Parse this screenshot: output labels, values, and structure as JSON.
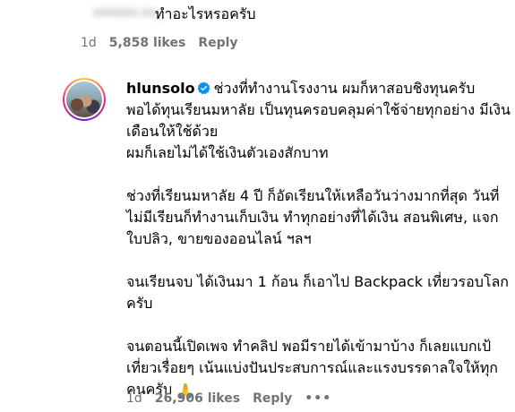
{
  "top_comment": {
    "username": "xxxxxx.xx_",
    "text": "ทำอะไรหรอครับ",
    "time": "1d",
    "likes": "5,858 likes",
    "reply_label": "Reply"
  },
  "reply_comment": {
    "username": "hlunsolo",
    "paragraphs": [
      "ช่วงที่ทำงานโรงงาน ผมก็หาสอบชิงทุนครับ พอได้ทุนเรียนมหาลัย เป็นทุนครอบคลุมค่าใช้จ่ายทุกอย่าง มีเงินเดือนให้ใช้ด้วย",
      "ผมก็เลยไม่ได้ใช้เงินตัวเองสักบาท",
      "ช่วงที่เรียนมหาลัย 4 ปี ก็อัดเรียนให้เหลือวันว่างมากที่สุด วันที่ไม่มีเรียนก็ทำงานเก็บเงิน ทำทุกอย่างที่ได้เงิน สอนพิเศษ, แจกใบปลิว, ขายของออนไลน์ ฯลฯ",
      "จนเรียนจบ ได้เงินมา 1 ก้อน ก็เอาไป Backpack เที่ยวรอบโลกครับ",
      "จนตอนนี้เปิดเพจ ทำคลิป พอมีรายได้เข้ามาบ้าง ก็เลยแบกเป้เที่ยวเรื่อยๆ เน้นแบ่งปันประสบการณ์และแรงบรรดาลใจให้ทุกคนครับ"
    ],
    "emoji": "🙏",
    "time": "1d",
    "likes": "26,906 likes",
    "reply_label": "Reply",
    "more_label": "•••"
  },
  "colors": {
    "text": "#000000",
    "meta": "#737373",
    "verified": "#0095f6"
  },
  "icons": [
    "verified-badge-icon",
    "praying-hands-icon",
    "more-options-icon"
  ]
}
